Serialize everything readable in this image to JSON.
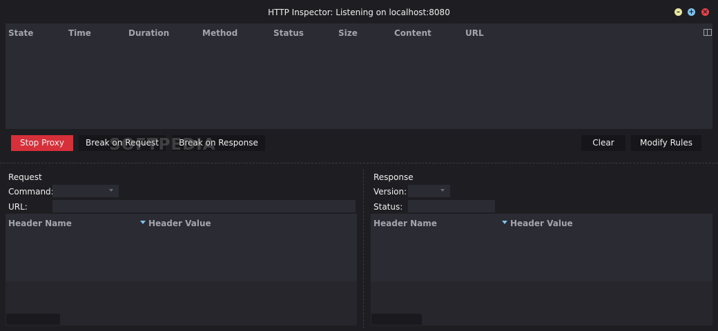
{
  "window": {
    "title": "HTTP Inspector: Listening on localhost:8080",
    "controls": {
      "minimize": "–",
      "maximize": "+",
      "close": "×"
    }
  },
  "traffic_grid": {
    "columns": [
      "State",
      "Time",
      "Duration",
      "Method",
      "Status",
      "Size",
      "Content",
      "URL"
    ],
    "rows": []
  },
  "toolbar": {
    "stop_proxy": "Stop Proxy",
    "break_on_request": "Break on Request",
    "break_on_response": "Break on Response",
    "clear": "Clear",
    "modify_rules": "Modify Rules"
  },
  "watermark": "SOFTPEDIA",
  "request": {
    "title": "Request",
    "command_label": "Command:",
    "command_value": "",
    "url_label": "URL:",
    "url_value": "",
    "headers": {
      "name_col": "Header Name",
      "value_col": "Header Value",
      "rows": []
    }
  },
  "response": {
    "title": "Response",
    "version_label": "Version:",
    "version_value": "",
    "status_label": "Status:",
    "status_value": "",
    "headers": {
      "name_col": "Header Name",
      "value_col": "Header Value",
      "rows": []
    }
  },
  "colors": {
    "accent_red": "#d6303a",
    "sort_arrow": "#7fc4ef",
    "panel_bg": "#2b2b33",
    "window_bg": "#1e1e22"
  }
}
